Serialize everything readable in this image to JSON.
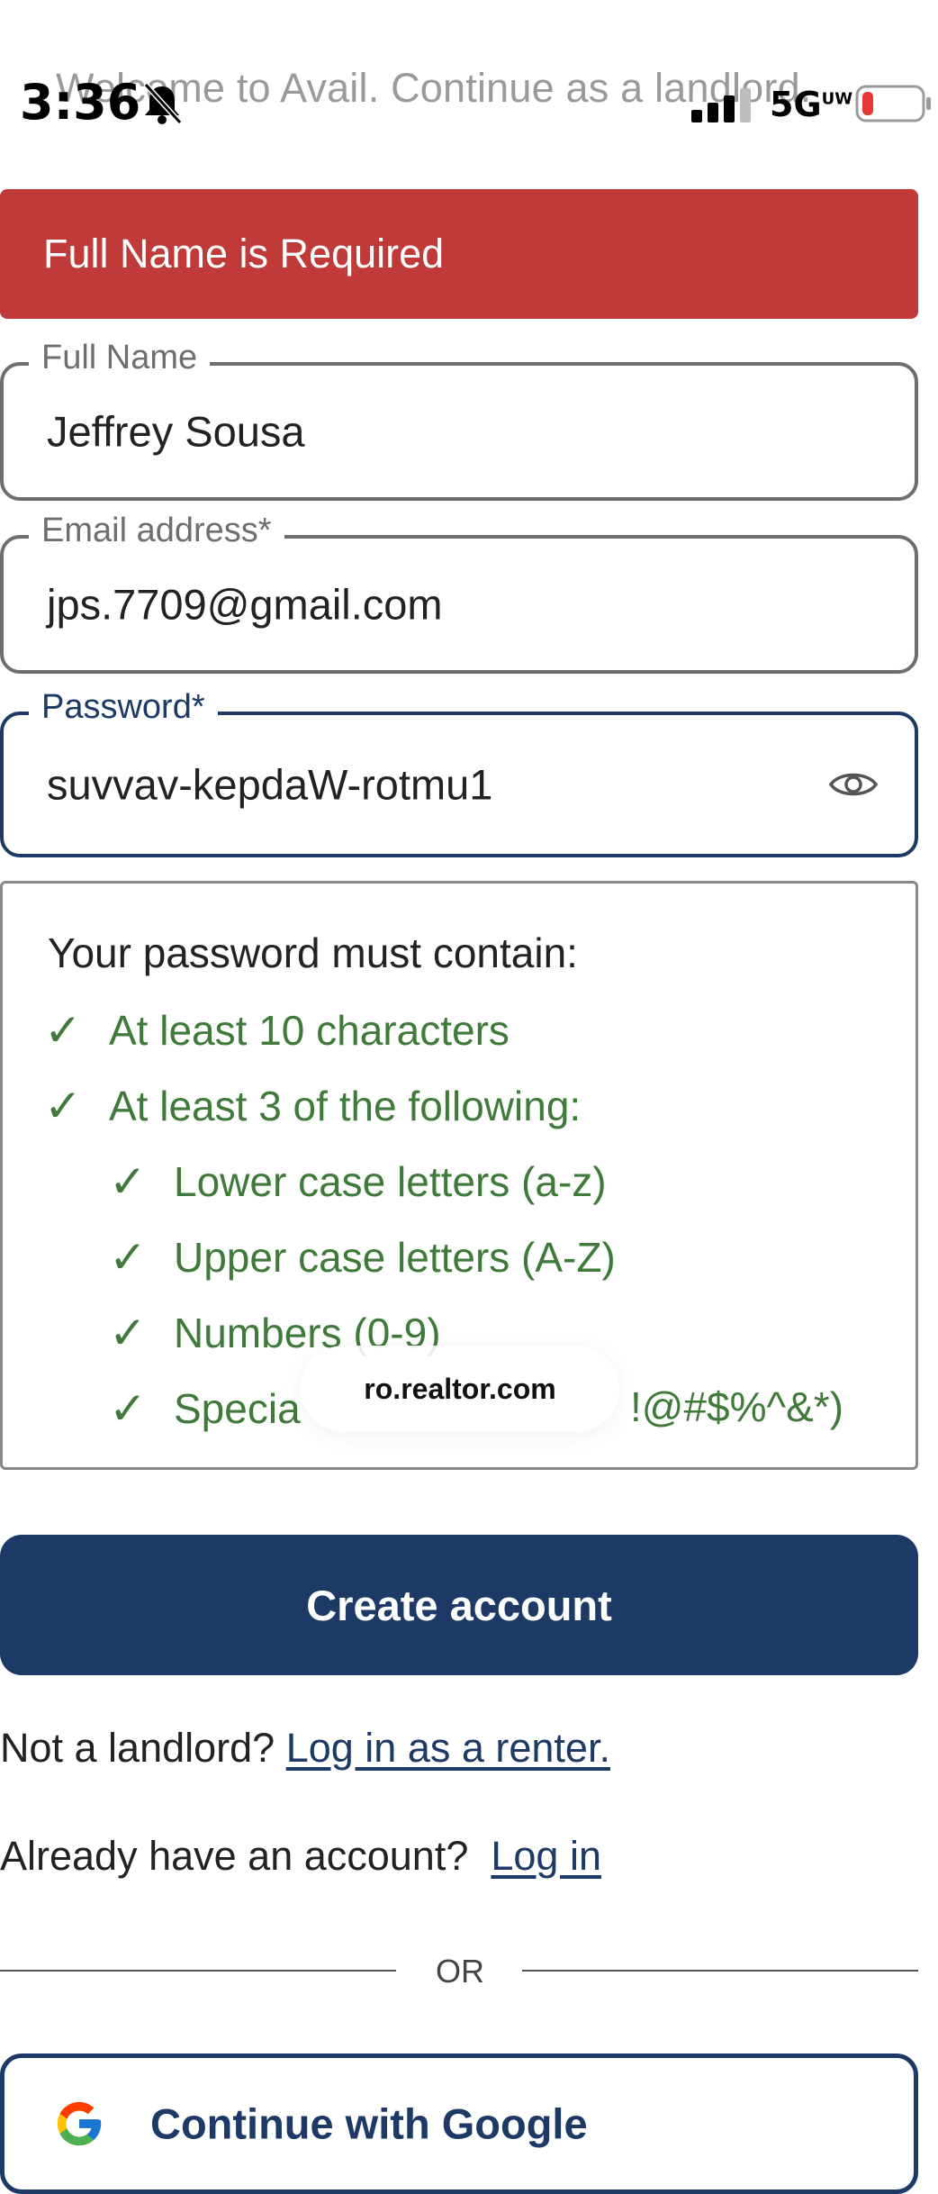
{
  "status_bar": {
    "time": "3:36",
    "network": "5G",
    "network_sub": "UW"
  },
  "header": {
    "welcome_text": "Welcome to Avail. Continue as a landlord."
  },
  "error": {
    "message": "Full Name is Required"
  },
  "form": {
    "full_name": {
      "label": "Full Name",
      "value": "Jeffrey Sousa"
    },
    "email": {
      "label": "Email address*",
      "value": "jps.7709@gmail.com"
    },
    "password": {
      "label": "Password*",
      "value": "suvvav-kepdaW-rotmu1"
    }
  },
  "requirements": {
    "title": "Your password must contain:",
    "check_symbol": "✓",
    "items": [
      {
        "text": "At least 10 characters"
      },
      {
        "text": "At least 3 of the following:"
      },
      {
        "text": "Lower case letters (a-z)"
      },
      {
        "text": "Upper case letters (A-Z)"
      },
      {
        "text": "Numbers (0-9)"
      },
      {
        "text_start": "Specia",
        "text_end": "!@#$%^&*)"
      }
    ]
  },
  "toast": {
    "url_text": "ro.realtor.com"
  },
  "actions": {
    "create_account": "Create account",
    "not_landlord_text": "Not a landlord?",
    "renter_link": "Log in as a renter.",
    "have_account_text": "Already have an account?",
    "login_link": "Log in",
    "or_label": "OR",
    "google_button": "Continue with Google"
  },
  "colors": {
    "error": "#bf3a38",
    "primary": "#1d3966",
    "success": "#3f7a3a"
  }
}
